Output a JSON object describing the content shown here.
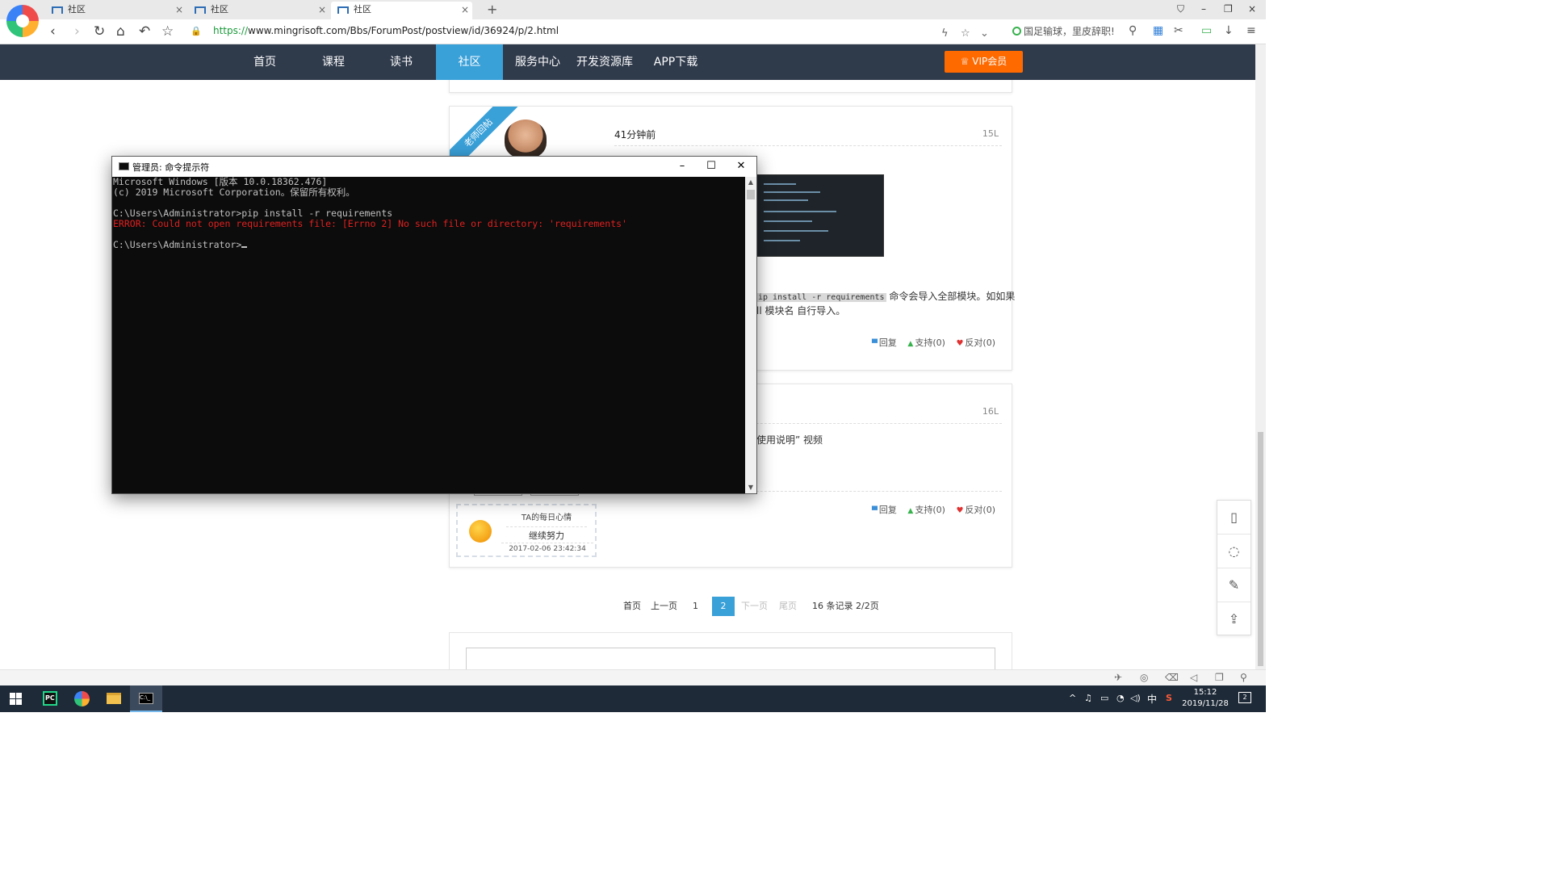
{
  "browser": {
    "tabs": [
      {
        "label": "社区"
      },
      {
        "label": "社区"
      },
      {
        "label": "社区"
      }
    ],
    "url_scheme": "https://",
    "url_rest": "www.mingrisoft.com/Bbs/ForumPost/postview/id/36924/p/2.html",
    "search_text": "国足输球，里皮辞职!",
    "icons": {
      "close": "×",
      "new_tab": "+",
      "back": "‹",
      "forward": "›",
      "reload": "↻",
      "home": "⌂",
      "undo": "↶",
      "star": "☆",
      "bolt": "ϟ",
      "chevron": "⌄",
      "search": "⚲",
      "scissors": "✂",
      "download": "↓",
      "menu": "≡",
      "minimize": "–",
      "restore": "❐",
      "shirt": "⛉"
    }
  },
  "site_nav": {
    "items": [
      "首页",
      "课程",
      "读书",
      "社区",
      "服务中心",
      "开发资源库",
      "APP下载"
    ],
    "active_index": 3,
    "vip_label": "VIP会员",
    "accent": "#3aa0d8",
    "bg": "#2f3a4b"
  },
  "posts": [
    {
      "ribbon": "老师回帖",
      "time": "41分钟前",
      "floor": "15L",
      "text_code": "ip install -r requirements",
      "text_after": " 命令会导入全部模块。如如果",
      "text_line2": "ll 模块名  自行导入。",
      "reply": "回复",
      "support": "支持(0)",
      "oppose": "反对(0)"
    },
    {
      "floor": "16L",
      "text": "使用说明” 视频",
      "reply": "回复",
      "support": "支持(0)",
      "oppose": "反对(0)",
      "mood_title": "TA的每日心情",
      "mood_text": "继续努力",
      "mood_date": "2017-02-06 23:42:34"
    }
  ],
  "pagination": {
    "first": "首页",
    "prev": "上一页",
    "page1": "1",
    "current": "2",
    "next": "下一页",
    "last": "尾页",
    "summary": "16 条记录 2/2页"
  },
  "cmd": {
    "title": "管理员: 命令提示符",
    "line1": "Microsoft Windows [版本 10.0.18362.476]",
    "line2": "(c) 2019 Microsoft Corporation。保留所有权利。",
    "line3": "C:\\Users\\Administrator>pip install -r requirements",
    "error_line": "ERROR: Could not open requirements file: [Errno 2] No such file or directory: 'requirements'",
    "prompt": "C:\\Users\\Administrator>",
    "icons": {
      "minimize": "–",
      "maximize": "☐",
      "close": "✕",
      "up": "▲",
      "down": "▼"
    }
  },
  "taskbar": {
    "pycharm_label": "PC",
    "cmd_label": "C:\\_",
    "ime": "中",
    "time": "15:12",
    "date": "2019/11/28",
    "notifications": "2",
    "icons": {
      "chevron_up": "^",
      "bell": "♫",
      "battery": "▭",
      "wifi": "◔",
      "volume": "◁)",
      "sogou": "S"
    }
  },
  "statusbar_icons": [
    "✈",
    "◎",
    "⌫",
    "◁",
    "❐",
    "⚲"
  ],
  "float_bar_icons": [
    "▯",
    "◌",
    "✎",
    "⇪"
  ]
}
